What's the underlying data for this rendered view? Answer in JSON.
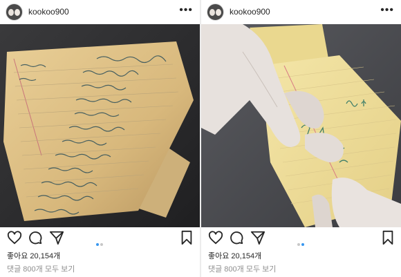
{
  "posts": [
    {
      "username": "kookoo900",
      "more_label": "•••",
      "likes_text": "좋아요 20,154개",
      "comments_text": "댓글 800개 모두 보기",
      "carousel": {
        "total": 2,
        "active": 1
      }
    },
    {
      "username": "kookoo900",
      "more_label": "•••",
      "likes_text": "좋아요 20,154개",
      "comments_text": "댓글 800개 모두 보기",
      "carousel": {
        "total": 2,
        "active": 2
      }
    }
  ],
  "icons": [
    "heart-icon",
    "comment-icon",
    "share-icon",
    "bookmark-icon",
    "more-icon"
  ],
  "colors": {
    "active_dot": "#3897f0",
    "inactive_dot": "#c7c7c7",
    "text": "#262626",
    "muted": "#8e8e8e"
  }
}
